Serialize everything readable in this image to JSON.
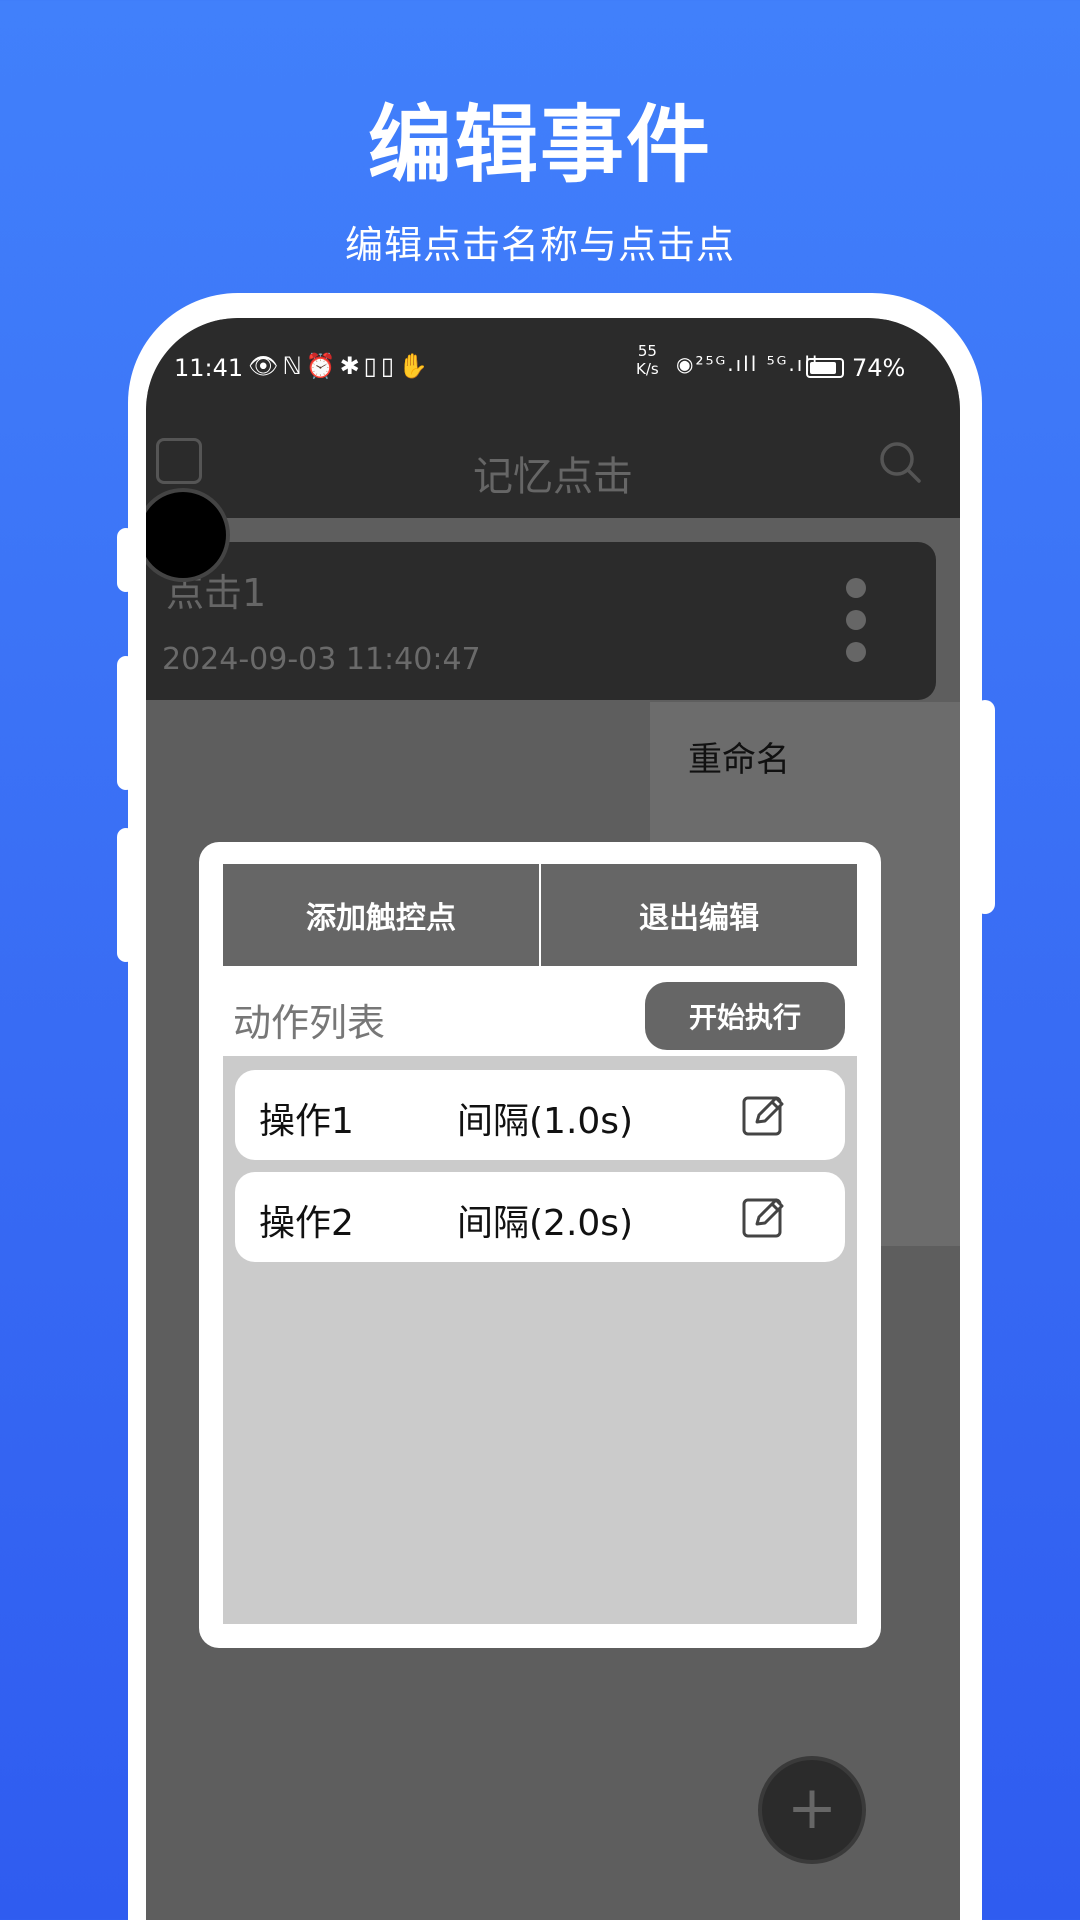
{
  "promo": {
    "title": "编辑事件",
    "subtitle": "编辑点击名称与点击点"
  },
  "status_bar": {
    "time": "11:41",
    "net_speed_value": "55",
    "net_speed_unit": "K/s",
    "left_icons": "👁ℕ⏰✱▯▯✋",
    "right_icons": "◉²⁵ᴳ.ıll ⁵ᴳ.ıll",
    "battery": "74%"
  },
  "app_bar": {
    "title": "记忆点击"
  },
  "event_card": {
    "name": "点击1",
    "timestamp": "2024-09-03 11:40:47"
  },
  "context_menu": {
    "rename": "重命名"
  },
  "dialog": {
    "add_touch_point": "添加触控点",
    "exit_edit": "退出编辑",
    "list_title": "动作列表",
    "start_execute": "开始执行",
    "operations": [
      {
        "name": "操作1",
        "interval": "间隔(1.0s)"
      },
      {
        "name": "操作2",
        "interval": "间隔(2.0s)"
      }
    ]
  },
  "fab": {
    "label": "+"
  }
}
